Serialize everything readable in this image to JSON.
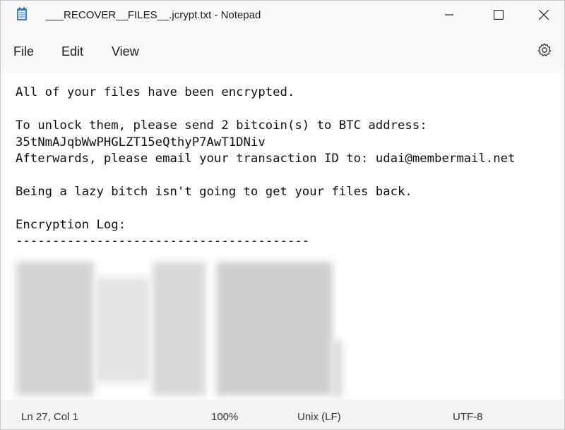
{
  "window": {
    "title": "___RECOVER__FILES__.jcrypt.txt - Notepad",
    "app_icon": "notepad-icon",
    "controls": {
      "minimize": "minimize-icon",
      "maximize": "maximize-icon",
      "close": "close-icon"
    }
  },
  "menu": {
    "file": "File",
    "edit": "Edit",
    "view": "View",
    "settings_icon": "gear-icon"
  },
  "content": {
    "line1": "All of your files have been encrypted.",
    "line2": "To unlock them, please send 2 bitcoin(s) to BTC address:",
    "line3": "35tNmAJqbWwPHGLZT15eQthyP7AwT1DNiv",
    "line4": "Afterwards, please email your transaction ID to: udai@membermail.net",
    "line5": "Being a lazy bitch isn't going to get your files back.",
    "line6": "Encryption Log:",
    "line7": "----------------------------------------"
  },
  "status": {
    "position": "Ln 27, Col 1",
    "zoom": "100%",
    "line_ending": "Unix (LF)",
    "encoding": "UTF-8"
  }
}
